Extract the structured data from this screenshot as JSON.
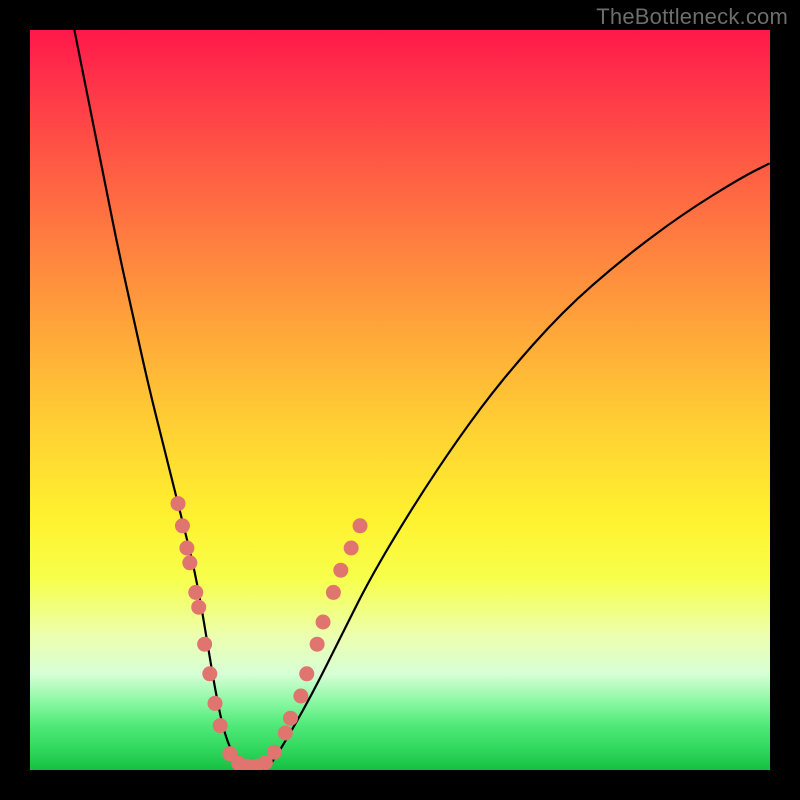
{
  "watermark": "TheBottleneck.com",
  "colors": {
    "frame": "#000000",
    "curve": "#000000",
    "dot": "#e0746f",
    "gradient_top": "#ff1849",
    "gradient_bottom": "#13bf41"
  },
  "chart_data": {
    "type": "line",
    "title": "",
    "xlabel": "",
    "ylabel": "",
    "xlim": [
      0,
      100
    ],
    "ylim": [
      0,
      100
    ],
    "series": [
      {
        "name": "bottleneck-curve",
        "x": [
          6,
          8,
          10,
          12,
          14,
          16,
          18,
          20,
          21,
          22,
          23,
          24,
          25,
          26,
          27,
          28,
          30,
          32,
          34,
          38,
          42,
          46,
          52,
          58,
          64,
          72,
          80,
          88,
          96,
          100
        ],
        "y": [
          100,
          90,
          80,
          70,
          61,
          52,
          44,
          36,
          32,
          28,
          23,
          17,
          11,
          6,
          3,
          1,
          0,
          0,
          3,
          10,
          18,
          26,
          36,
          45,
          53,
          62,
          69,
          75,
          80,
          82
        ]
      }
    ],
    "markers": {
      "name": "highlighted-points",
      "points": [
        {
          "x": 20.0,
          "y": 36
        },
        {
          "x": 20.6,
          "y": 33
        },
        {
          "x": 21.2,
          "y": 30
        },
        {
          "x": 21.6,
          "y": 28
        },
        {
          "x": 22.4,
          "y": 24
        },
        {
          "x": 22.8,
          "y": 22
        },
        {
          "x": 23.6,
          "y": 17
        },
        {
          "x": 24.3,
          "y": 13
        },
        {
          "x": 25.0,
          "y": 9
        },
        {
          "x": 25.7,
          "y": 6
        },
        {
          "x": 27.0,
          "y": 2.2
        },
        {
          "x": 28.2,
          "y": 0.9
        },
        {
          "x": 29.4,
          "y": 0.5
        },
        {
          "x": 30.6,
          "y": 0.5
        },
        {
          "x": 31.8,
          "y": 1.0
        },
        {
          "x": 33.0,
          "y": 2.4
        },
        {
          "x": 34.5,
          "y": 5
        },
        {
          "x": 35.2,
          "y": 7
        },
        {
          "x": 36.6,
          "y": 10
        },
        {
          "x": 37.4,
          "y": 13
        },
        {
          "x": 38.8,
          "y": 17
        },
        {
          "x": 39.6,
          "y": 20
        },
        {
          "x": 41.0,
          "y": 24
        },
        {
          "x": 42.0,
          "y": 27
        },
        {
          "x": 43.4,
          "y": 30
        },
        {
          "x": 44.6,
          "y": 33
        }
      ]
    }
  }
}
